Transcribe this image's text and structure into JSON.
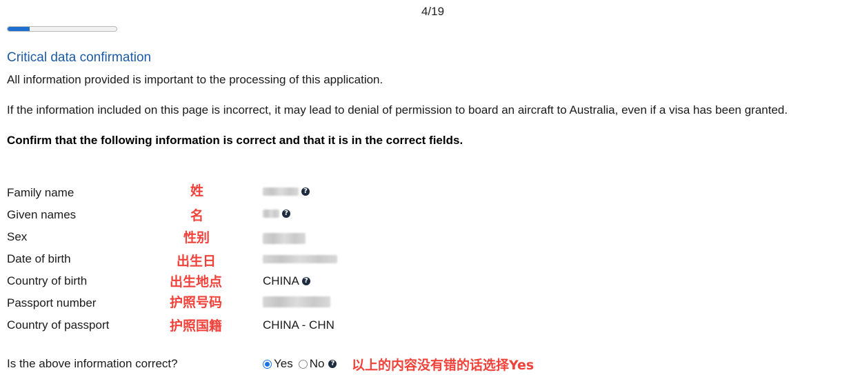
{
  "progress": {
    "counter": "4/19",
    "fraction": 0.2
  },
  "section": {
    "title": "Critical data confirmation",
    "intro": "All information provided is important to the processing of this application.",
    "warning": "If the information included on this page is incorrect, it may lead to denial of permission to board an aircraft to Australia, even if a visa has been granted.",
    "instruction": "Confirm that the following information is correct and that it is in the correct fields."
  },
  "rows": [
    {
      "label": "Family name",
      "annotation": "姓",
      "value": "",
      "redacted": true,
      "help": true
    },
    {
      "label": "Given names",
      "annotation": "名",
      "value": "",
      "redacted": true,
      "help": true
    },
    {
      "label": "Sex",
      "annotation": "性别",
      "value": "",
      "redacted": true,
      "help": false
    },
    {
      "label": "Date of birth",
      "annotation": "出生日",
      "value": "",
      "redacted": true,
      "help": false
    },
    {
      "label": "Country of birth",
      "annotation": "出生地点",
      "value": "CHINA",
      "redacted": false,
      "help": true
    },
    {
      "label": "Passport number",
      "annotation": "护照号码",
      "value": "",
      "redacted": true,
      "help": false
    },
    {
      "label": "Country of passport",
      "annotation": "护照国籍",
      "value": "CHINA - CHN",
      "redacted": false,
      "help": false
    }
  ],
  "confirm": {
    "question": "Is the above information correct?",
    "yes_label": "Yes",
    "no_label": "No",
    "selected": "Yes",
    "annotation": "以上的内容没有错的话选择Yes"
  },
  "colors": {
    "accent": "#1c5aa6",
    "annotation": "#f0423a",
    "progress": "#1f6fd1"
  }
}
